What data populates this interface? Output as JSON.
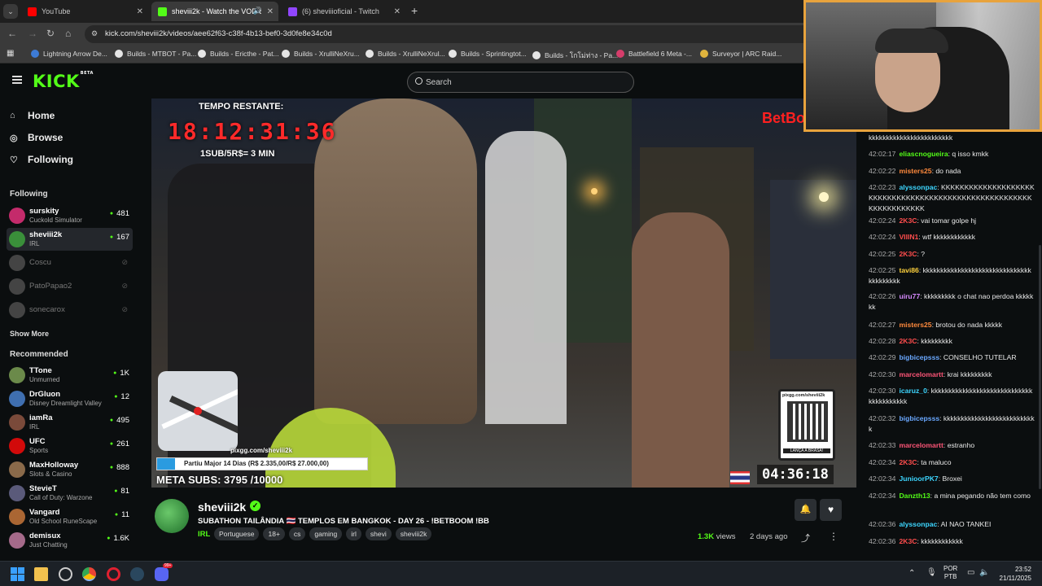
{
  "browser": {
    "tabs": [
      {
        "label": "YouTube",
        "color": "#ff0000"
      },
      {
        "label": "sheviii2k - Watch the VOD o",
        "color": "#53fc18"
      },
      {
        "label": "(6) sheviiioficial - Twitch",
        "color": "#9146ff"
      }
    ],
    "new_tab": "+",
    "url": "kick.com/sheviii2k/videos/aee62f63-c38f-4b13-bef0-3d0fe8e34c0d",
    "bookmarks": [
      "Lightning Arrow De...",
      "Builds - MTBOT - Pa...",
      "Builds - Ericthe - Pat...",
      "Builds - XrulliNeXru...",
      "Builds - XrulliNeXrul...",
      "Builds - Sprintingtot...",
      "Builds - โกโม่ท่าง - Pa...",
      "Battlefield 6 Meta -...",
      "Surveyor | ARC Raid..."
    ]
  },
  "kick": {
    "logo": "KICK",
    "logo_sup": "BETA",
    "search_placeholder": "Search"
  },
  "sidebar": {
    "nav": [
      {
        "label": "Home",
        "icon": "home-icon"
      },
      {
        "label": "Browse",
        "icon": "compass-icon"
      },
      {
        "label": "Following",
        "icon": "heart-icon"
      }
    ],
    "following_title": "Following",
    "following": [
      {
        "name": "surskity",
        "sub": "Cuckold Simulator",
        "count": "481",
        "live": true,
        "color": "#c42b6b"
      },
      {
        "name": "sheviii2k",
        "sub": "IRL",
        "count": "167",
        "live": true,
        "color": "#3a8f3a"
      },
      {
        "name": "Coscu",
        "live": false,
        "color": "#444"
      },
      {
        "name": "PatoPapao2",
        "live": false,
        "color": "#444"
      },
      {
        "name": "sonecarox",
        "live": false,
        "color": "#444"
      }
    ],
    "show_more": "Show More",
    "recommended_title": "Recommended",
    "recommended": [
      {
        "name": "TTone",
        "sub": "Unmurned",
        "count": "1K",
        "color": "#6b8a4a"
      },
      {
        "name": "DrGluon",
        "sub": "Disney Dreamlight Valley",
        "count": "12",
        "color": "#3f6fb0"
      },
      {
        "name": "iamRa",
        "sub": "IRL",
        "count": "495",
        "color": "#7a4a3a"
      },
      {
        "name": "UFC",
        "sub": "Sports",
        "count": "261",
        "color": "#d20a0a"
      },
      {
        "name": "MaxHolloway",
        "sub": "Slots & Casino",
        "count": "888",
        "color": "#8a6a4a"
      },
      {
        "name": "StevieT",
        "sub": "Call of Duty: Warzone",
        "count": "81",
        "color": "#5a5a7a"
      },
      {
        "name": "Vangard",
        "sub": "Old School RuneScape",
        "count": "11",
        "color": "#aa6633"
      },
      {
        "name": "demisux",
        "sub": "Just Chatting",
        "count": "1.6K",
        "color": "#a56a8a"
      }
    ]
  },
  "video": {
    "overlay_timer_label": "TEMPO RESTANTE:",
    "overlay_timer": "18:12:31:36",
    "overlay_rate": "1SUB/5R$= 3 MIN",
    "brand": "BetBo",
    "progress_label": "Partiu Major 14 Dias (R$ 2.335,00/R$ 27.000,00)",
    "progress_fraction": 0.086,
    "map_caption": "pixgg.com/sheviii2k",
    "meta_subs": "META SUBS: 3795 /10000",
    "qr_title": "pixgg.com/sheviii2k",
    "qr_caption": "LANÇA A BRASA!",
    "clock": "04:36:18"
  },
  "info": {
    "channel": "sheviii2k",
    "title": "SUBATHON TAILÂNDIA 🇹🇭 TEMPLOS EM BANGKOK - DAY 26 - !BETBOOM !BB",
    "category": "IRL",
    "tags": [
      "Portuguese",
      "18+",
      "cs",
      "gaming",
      "irl",
      "shevi",
      "sheviii2k"
    ],
    "views": "1.3K",
    "views_label": "views",
    "ago": "2 days ago"
  },
  "chat": [
    {
      "text": "kkkkkkkkkkkkkkkkkkkkkkkk"
    },
    {
      "ts": "42:02:17",
      "user": "eliascnogueira",
      "color": "#53fc18",
      "text": "q isso kmkk"
    },
    {
      "ts": "42:02:22",
      "user": "misters25",
      "color": "#ff8a3d",
      "text": "do nada"
    },
    {
      "ts": "42:02:23",
      "user": "alyssonpac",
      "color": "#3dd6ff",
      "text": "KKKKKKKKKKKKKKKKKKKKKKKKKKKKKKKKKKKKKKKKKKKKKKKKKKKKKKKKKKKKKKKKKKK"
    },
    {
      "ts": "42:02:24",
      "user": "2K3C",
      "color": "#ff4d4d",
      "text": "vai tomar golpe hj"
    },
    {
      "ts": "42:02:24",
      "user": "VIIIN1",
      "color": "#ff4d4d",
      "text": "wtf kkkkkkkkkkkk"
    },
    {
      "ts": "42:02:25",
      "user": "2K3C",
      "color": "#ff4d4d",
      "text": "?"
    },
    {
      "ts": "42:02:25",
      "user": "tavi86",
      "color": "#ffd23d",
      "text": "kkkkkkkkkkkkkkkkkkkkkkkkkkkkkkkkkkkkkkkk"
    },
    {
      "ts": "42:02:26",
      "user": "uiru77",
      "color": "#d68aff",
      "text": "kkkkkkkkk o chat nao perdoa kkkkkkk"
    },
    {
      "ts": "42:02:27",
      "user": "misters25",
      "color": "#ff8a3d",
      "text": "brotou do nada kkkkk"
    },
    {
      "ts": "42:02:28",
      "user": "2K3C",
      "color": "#ff4d4d",
      "text": "kkkkkkkkk"
    },
    {
      "ts": "42:02:29",
      "user": "bigbicepsss",
      "color": "#6aa8ff",
      "text": "CONSELHO TUTELAR"
    },
    {
      "ts": "42:02:30",
      "user": "marcelomartt",
      "color": "#ff5577",
      "text": "krai kkkkkkkkk"
    },
    {
      "ts": "42:02:30",
      "user": "icaruz_0",
      "color": "#3dd6ff",
      "text": "kkkkkkkkkkkkkkkkkkkkkkkkkkkkkkkkkkkkkkkk"
    },
    {
      "ts": "42:02:32",
      "user": "bigbicepsss",
      "color": "#6aa8ff",
      "text": "kkkkkkkkkkkkkkkkkkkkkkkkkkk"
    },
    {
      "ts": "42:02:33",
      "user": "marcelomartt",
      "color": "#ff5577",
      "text": "estranho"
    },
    {
      "ts": "42:02:34",
      "user": "2K3C",
      "color": "#ff4d4d",
      "text": "ta maluco"
    },
    {
      "ts": "42:02:34",
      "user": "JunioorPK7",
      "color": "#3dd6ff",
      "text": "Broxei"
    },
    {
      "ts": "42:02:34",
      "user": "Danzth13",
      "color": "#53fc18",
      "text": "a mina pegando não tem como"
    },
    {
      "ts": "42:02:36",
      "user": "alyssonpac",
      "color": "#3dd6ff",
      "text": "AI NAO TANKEI"
    },
    {
      "ts": "42:02:36",
      "user": "2K3C",
      "color": "#ff4d4d",
      "text": "kkkkkkkkkkkk"
    }
  ],
  "taskbar": {
    "lang_top": "POR",
    "lang_bottom": "PTB",
    "time": "23:52",
    "date": "21/11/2025",
    "discord_badge": "99+"
  }
}
